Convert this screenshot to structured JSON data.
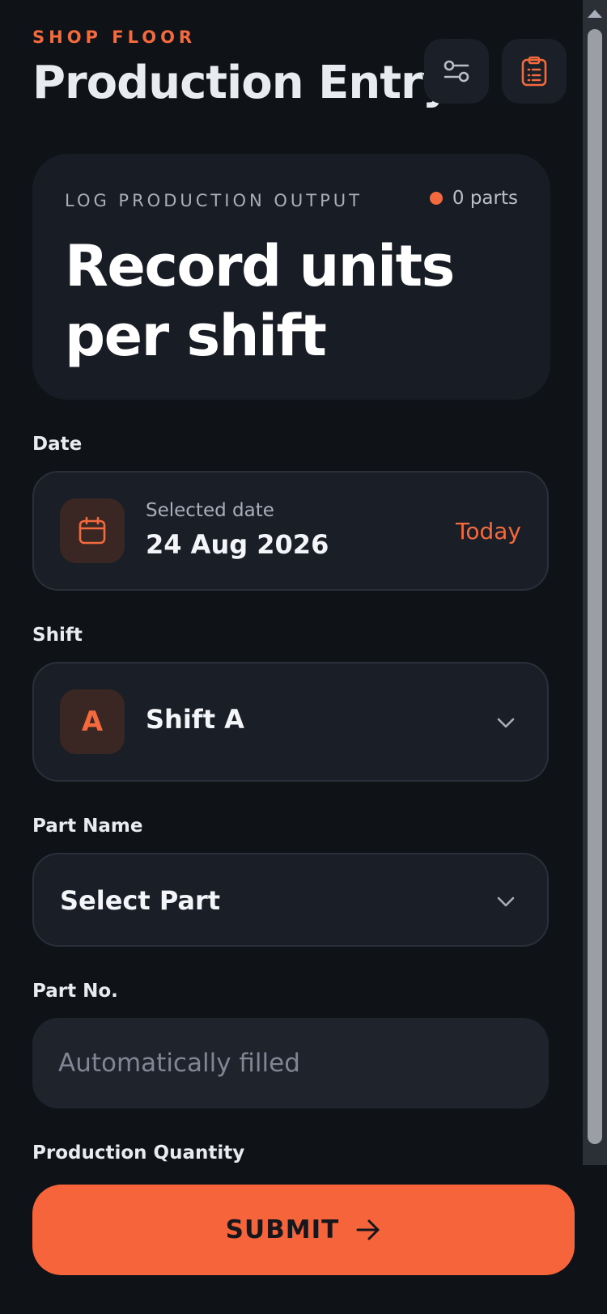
{
  "header": {
    "eyebrow": "SHOP FLOOR",
    "title": "Production Entry",
    "filters_icon": "sliders-icon",
    "clipboard_icon": "clipboard-list-icon"
  },
  "hero": {
    "kicker": "LOG PRODUCTION OUTPUT",
    "count_label": "0 parts",
    "headline": "Record units per shift"
  },
  "form": {
    "date": {
      "label": "Date",
      "caption": "Selected date",
      "value": "24 Aug 2026",
      "today_label": "Today"
    },
    "shift": {
      "label": "Shift",
      "badge": "A",
      "value": "Shift A"
    },
    "part_name": {
      "label": "Part Name",
      "value": "Select Part"
    },
    "part_no": {
      "label": "Part No.",
      "placeholder": "Automatically filled"
    },
    "production_quantity": {
      "label": "Production Quantity"
    }
  },
  "submit": {
    "label": "SUBMIT"
  },
  "colors": {
    "accent": "#f26a3d",
    "background": "#0f1217",
    "card": "#181c24"
  }
}
